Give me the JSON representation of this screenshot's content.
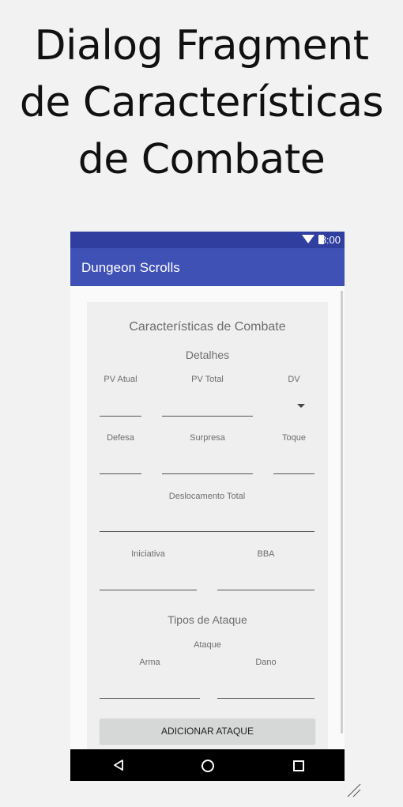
{
  "headline": [
    "Dialog Fragment",
    "de Características",
    "de Combate"
  ],
  "status_bar": {
    "time": "8:00"
  },
  "app_bar": {
    "title": "Dungeon Scrolls"
  },
  "dialog": {
    "title": "Características de Combate",
    "section_details": "Detalhes",
    "labels": {
      "pv_atual": "PV Atual",
      "pv_total": "PV Total",
      "dv": "DV",
      "defesa": "Defesa",
      "surpresa": "Surpresa",
      "toque": "Toque",
      "deslocamento": "Deslocamento Total",
      "iniciativa": "Iniciativa",
      "bba": "BBA",
      "tipos_ataque": "Tipos de Ataque",
      "ataque": "Ataque",
      "arma": "Arma",
      "dano": "Dano"
    },
    "add_button": "ADICIONAR ATAQUE"
  },
  "colors": {
    "status_bar": "#303f9f",
    "app_bar": "#3f51b5",
    "dialog_bg": "#efefef",
    "button_bg": "#d6d7d7"
  },
  "icons": [
    "wifi-icon",
    "battery-icon",
    "dropdown-arrow-icon",
    "nav-back-icon",
    "nav-home-icon",
    "nav-recent-icon"
  ]
}
